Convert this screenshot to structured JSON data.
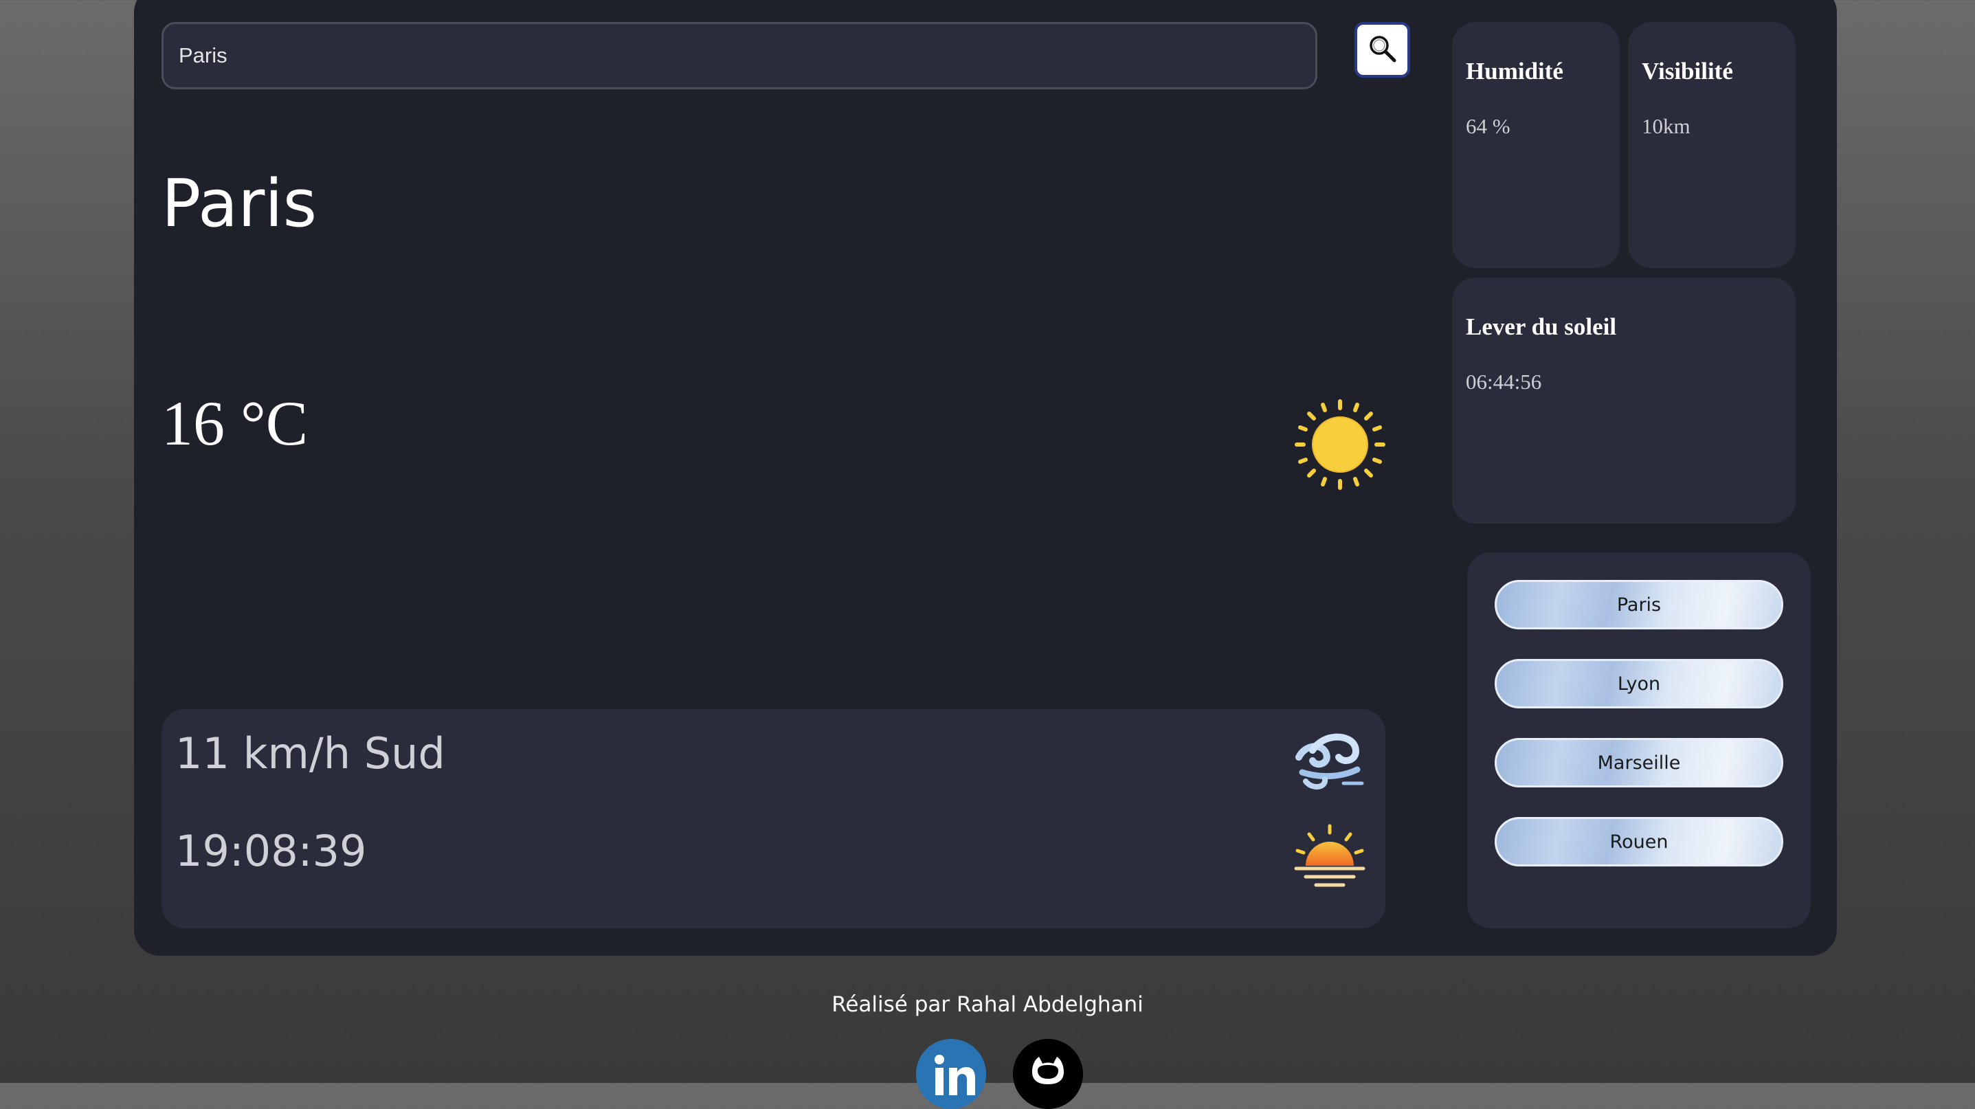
{
  "search": {
    "value": "Paris",
    "button_icon": "magnifier-icon"
  },
  "current": {
    "city": "Paris",
    "temperature": "16 °C",
    "condition_icon": "sun-icon",
    "wind": "11 km/h Sud",
    "wind_icon": "wind-icon",
    "sunset": "19:08:39",
    "sunset_icon": "sunset-icon"
  },
  "tiles": {
    "humidity": {
      "title": "Humidité",
      "value": "64 %"
    },
    "visibility": {
      "title": "Visibilité",
      "value": "10km"
    },
    "sunrise": {
      "title": "Lever du soleil",
      "value": "06:44:56"
    }
  },
  "quick_cities": [
    "Paris",
    "Lyon",
    "Marseille",
    "Rouen"
  ],
  "footer": {
    "credit": "Réalisé par Rahal Abdelghani",
    "linkedin_icon": "linkedin-icon",
    "github_icon": "github-icon"
  },
  "colors": {
    "app_bg": "#1f212a",
    "card_bg": "#2a2c3b",
    "sun_yellow": "#f7cf3c",
    "linkedin_blue": "#2a74b3"
  }
}
